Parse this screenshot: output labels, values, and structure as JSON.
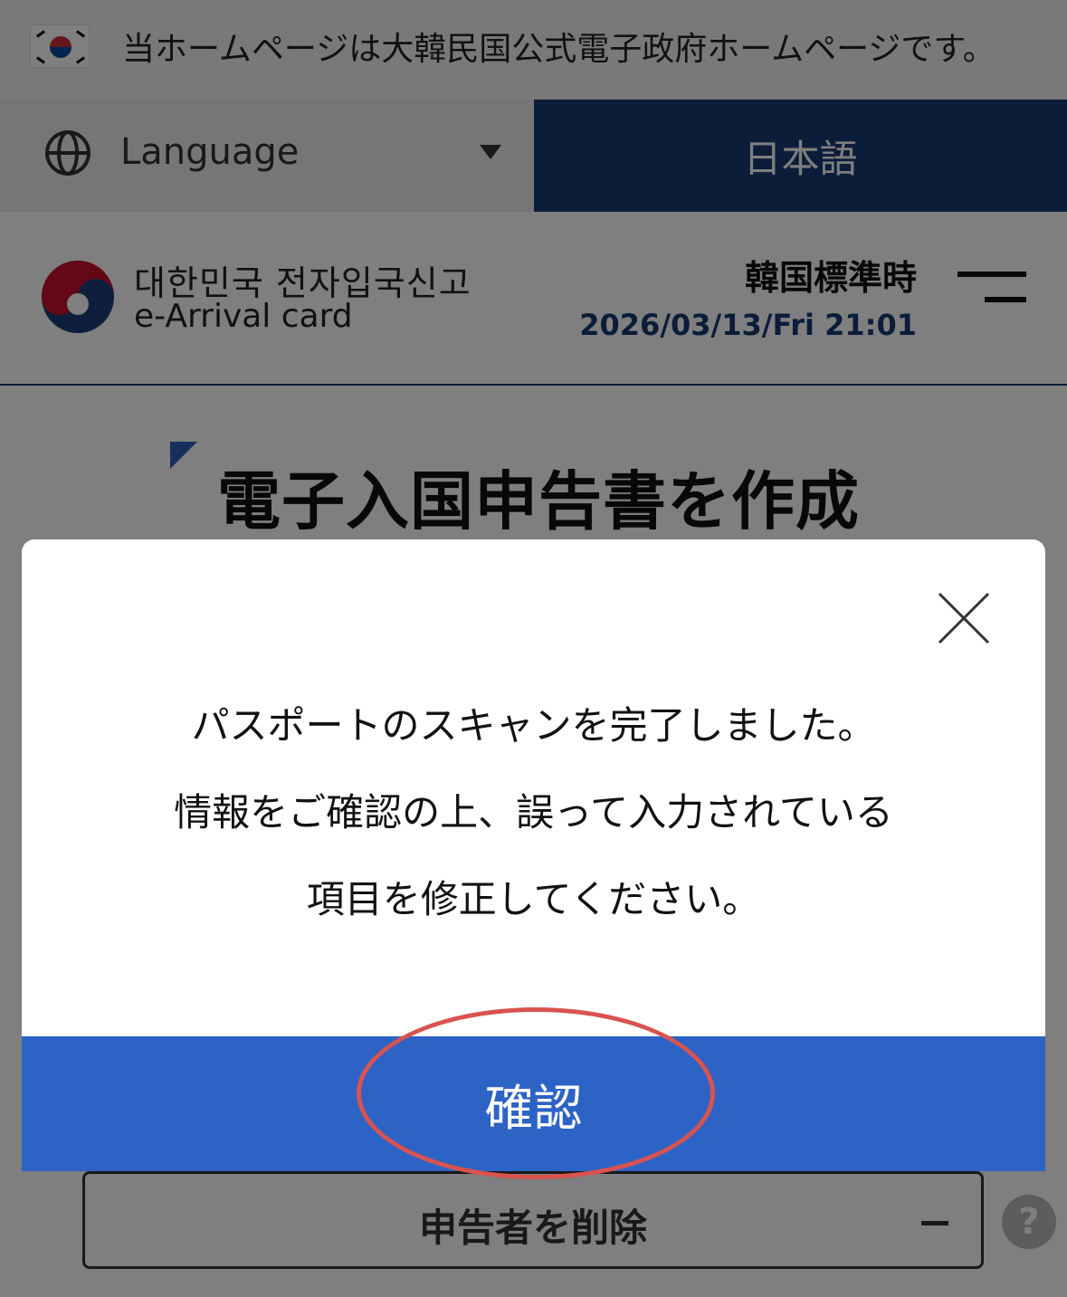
{
  "gov_banner": {
    "text": "当ホームページは大韓民国公式電子政府ホームページです。"
  },
  "language_bar": {
    "label": "Language",
    "current": "日本語"
  },
  "header": {
    "logo_ko": "대한민국 전자입국신고",
    "logo_en": "e-Arrival card",
    "timezone_label": "韓国標準時",
    "datetime": "2026/03/13/Fri 21:01"
  },
  "page": {
    "title": "電子入国申告書を作成"
  },
  "applicant": {
    "delete_label": "申告者を削除",
    "help": "?"
  },
  "modal": {
    "lines": [
      "パスポートのスキャンを完了しました。",
      "情報をご確認の上、誤って入力されている",
      "項目を修正してください。"
    ],
    "confirm_label": "確認"
  },
  "colors": {
    "navy": "#173a73",
    "primary_blue": "#2e63c6",
    "annotation_red": "#d9534f"
  }
}
